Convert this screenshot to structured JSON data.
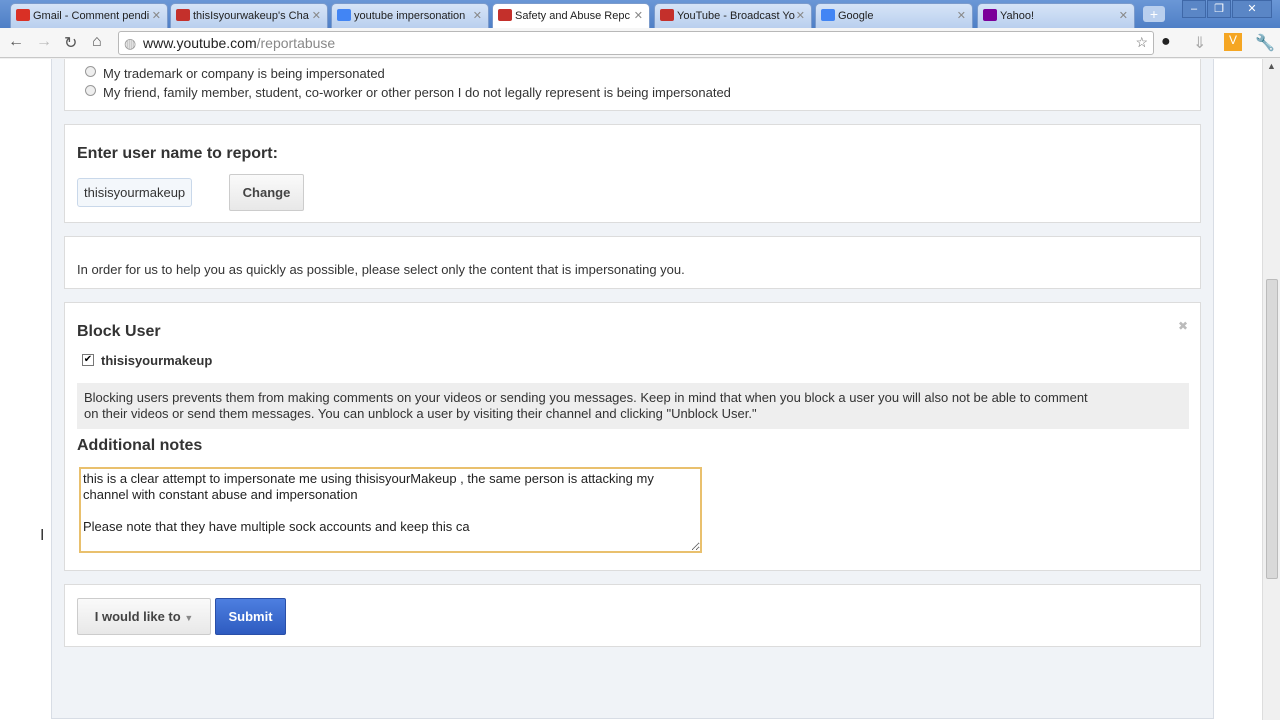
{
  "tabs": [
    {
      "label": "Gmail - Comment pendi",
      "color": "#d93025"
    },
    {
      "label": "thisIsyourwakeup's Cha",
      "color": "#c4302b"
    },
    {
      "label": "youtube impersonation",
      "color": "#4285f4"
    },
    {
      "label": "Safety and Abuse Repc",
      "color": "#c4302b"
    },
    {
      "label": "YouTube - Broadcast Yo",
      "color": "#c4302b"
    },
    {
      "label": "Google",
      "color": "#4285f4"
    },
    {
      "label": "Yahoo!",
      "color": "#7b0099"
    }
  ],
  "url": {
    "host": "www.youtube.com",
    "path": "/reportabuse"
  },
  "impersonation": {
    "options": [
      "My trademark or company is being impersonated",
      "My friend, family member, student, co-worker or other person I do not legally represent is being impersonated"
    ]
  },
  "username": {
    "heading": "Enter user name to report:",
    "value": "thisisyourmakeup",
    "change": "Change"
  },
  "notice": "In order for us to help you as quickly as possible, please select only the content that is impersonating you.",
  "block": {
    "heading": "Block User",
    "user": "thisisyourmakeup",
    "info1": "Blocking users prevents them from making comments on your videos or sending you messages. Keep in mind that when you block a user you will also not be able to comment",
    "info2": "on their videos or send them messages. You can unblock a user by visiting their channel and clicking \"Unblock User.\"",
    "notes_heading": "Additional notes",
    "notes": "this is a clear attempt to impersonate me using thisisyourMakeup , the same person is attacking my channel with constant abuse and impersonation\n\nPlease note that they have multiple sock accounts and keep this ca"
  },
  "actions": {
    "dropdown": "I would like to",
    "submit": "Submit"
  }
}
